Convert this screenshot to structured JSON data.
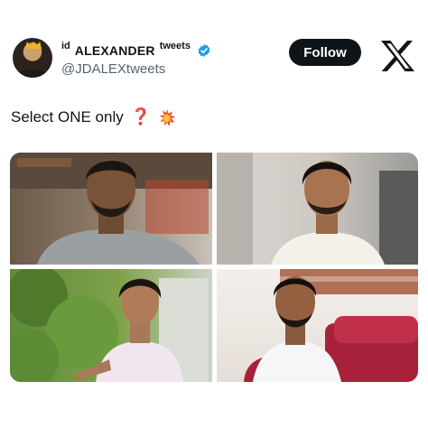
{
  "author": {
    "name_prefix": "id",
    "name_main": "ALEXANDER",
    "name_suffix": "tweets",
    "handle": "@JDALEXtweets"
  },
  "follow_label": "Follow",
  "tweet": {
    "text": "Select ONE only",
    "emoji_question": "❓"
  },
  "icons": {
    "verified": "verified-badge-icon",
    "brand": "x-logo-icon",
    "emoji_boom": "collision-emoji-icon"
  },
  "colors": {
    "verified": "#1d9bf0",
    "button": "#0f1419"
  }
}
